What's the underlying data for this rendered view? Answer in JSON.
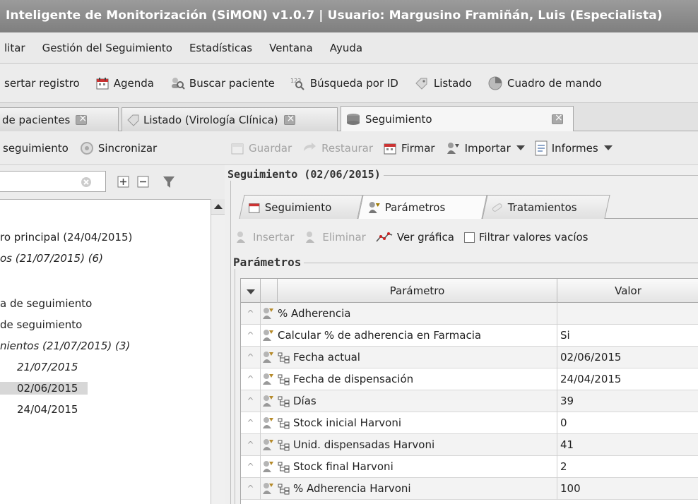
{
  "window": {
    "title": "Inteligente de Monitorización (SiMON) v1.0.7 | Usuario: Margusino Framiñán, Luis (Especialista)"
  },
  "menu": {
    "items": [
      "litar",
      "Gestión del Seguimiento",
      "Estadísticas",
      "Ventana",
      "Ayuda"
    ]
  },
  "toolbar": {
    "items": [
      {
        "label": "sertar registro",
        "icon": "insert-record-icon"
      },
      {
        "label": "Agenda",
        "icon": "calendar-icon"
      },
      {
        "label": "Buscar paciente",
        "icon": "search-patient-icon"
      },
      {
        "label": "Búsqueda por ID",
        "icon": "id-search-icon"
      },
      {
        "label": "Listado",
        "icon": "list-icon"
      },
      {
        "label": "Cuadro de mando",
        "icon": "dashboard-icon"
      }
    ]
  },
  "doc_tabs": [
    {
      "label": "de pacientes",
      "active": false
    },
    {
      "label": "Listado (Virología Clínica)",
      "active": false
    },
    {
      "label": "Seguimiento",
      "active": true
    }
  ],
  "left_toolbar": {
    "items": [
      {
        "label": "seguimiento"
      },
      {
        "label": "Sincronizar",
        "icon": "sync-icon"
      }
    ]
  },
  "left_search": {
    "value": "",
    "placeholder": ""
  },
  "tree": {
    "items": [
      {
        "label": "ro principal (24/04/2015)",
        "italic": false
      },
      {
        "label": "os (21/07/2015) (6)",
        "italic": true
      },
      {
        "label": "a de seguimiento",
        "italic": false
      },
      {
        "label": "de seguimiento",
        "italic": false
      },
      {
        "label": "nientos (21/07/2015) (3)",
        "italic": true
      },
      {
        "label": "21/07/2015",
        "italic": true
      },
      {
        "label": "02/06/2015",
        "italic": false,
        "selected": true
      },
      {
        "label": "24/04/2015",
        "italic": false
      }
    ]
  },
  "right_toolbar": {
    "items": [
      {
        "label": "Guardar",
        "icon": "save-icon",
        "enabled": false
      },
      {
        "label": "Restaurar",
        "icon": "restore-icon",
        "enabled": false
      },
      {
        "label": "Firmar",
        "icon": "sign-icon",
        "enabled": true
      },
      {
        "label": "Importar",
        "icon": "import-icon",
        "enabled": true,
        "dropdown": true
      },
      {
        "label": "Informes",
        "icon": "report-icon",
        "enabled": true,
        "dropdown": true
      }
    ]
  },
  "group": {
    "title": "Seguimiento (02/06/2015)"
  },
  "inner_tabs": [
    {
      "label": "Seguimiento",
      "active": false
    },
    {
      "label": "Parámetros",
      "active": true
    },
    {
      "label": "Tratamientos",
      "active": false
    }
  ],
  "param_toolbar": {
    "insert_label": "Insertar",
    "delete_label": "Eliminar",
    "chart_label": "Ver gráfica",
    "filter_label": "Filtrar valores vacíos",
    "filter_checked": false
  },
  "params": {
    "title": "Parámetros",
    "columns": [
      "Parámetro",
      "Valor"
    ],
    "rows": [
      {
        "name": "% Adherencia",
        "value": "",
        "child": false
      },
      {
        "name": "Calcular % de adherencia en Farmacia",
        "value": "Si",
        "child": false
      },
      {
        "name": "Fecha actual",
        "value": "02/06/2015",
        "child": true
      },
      {
        "name": "Fecha de dispensación",
        "value": "24/04/2015",
        "child": true
      },
      {
        "name": "Días",
        "value": "39",
        "child": true
      },
      {
        "name": "Stock inicial Harvoni",
        "value": "0",
        "child": true
      },
      {
        "name": "Unid. dispensadas Harvoni",
        "value": "41",
        "child": true
      },
      {
        "name": "Stock final Harvoni",
        "value": "2",
        "child": true
      },
      {
        "name": "% Adherencia Harvoni",
        "value": "100",
        "child": true
      }
    ]
  },
  "colors": {
    "titlebar": "#8b8b8b",
    "selected_row": "#d7d7d7",
    "disabled_text": "#a3a3a3"
  }
}
